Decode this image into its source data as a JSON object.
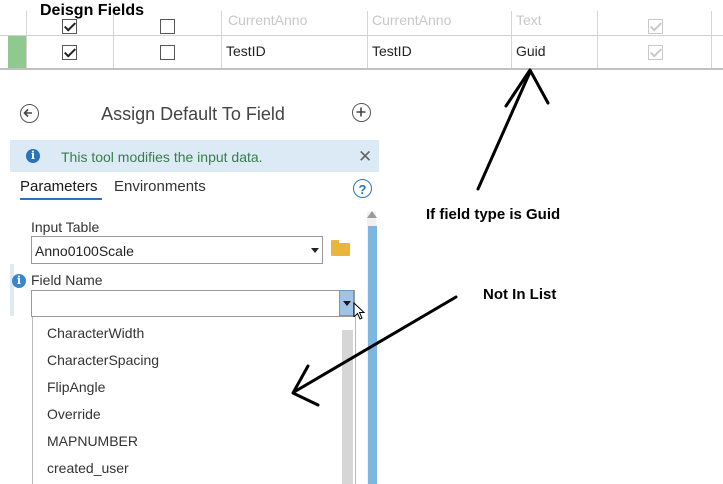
{
  "heading": "Deisgn Fields",
  "table": {
    "partial_row": {
      "col1": "CurrentAnno",
      "col2": "CurrentAnno",
      "col3": "Text"
    },
    "main_row": {
      "name": "TestID",
      "alias": "TestID",
      "type": "Guid"
    }
  },
  "pane": {
    "title": "Assign Default To Field",
    "info_message": "This tool modifies the input data.",
    "tabs": [
      {
        "label": "Parameters",
        "active": true
      },
      {
        "label": "Environments",
        "active": false
      }
    ],
    "help_glyph": "?",
    "input_table": {
      "label": "Input Table",
      "value": "Anno0100Scale"
    },
    "field_name": {
      "label": "Field Name",
      "value": ""
    },
    "dropdown_options": [
      "CharacterWidth",
      "CharacterSpacing",
      "FlipAngle",
      "Override",
      "MAPNUMBER",
      "created_user"
    ]
  },
  "annotations": {
    "guid_note": "If field type is Guid",
    "list_note": "Not In List"
  },
  "colors": {
    "accent_blue": "#2a73b8",
    "info_bar": "#dbeaf5",
    "info_text": "#3a7d4b",
    "row_marker_green": "#90c98e",
    "scroll_thumb": "#7eb6e2",
    "folder_yellow": "#e8b63a"
  },
  "icons": [
    "back-arrow-icon",
    "add-icon",
    "info-icon",
    "close-icon",
    "help-icon",
    "dropdown-arrow-icon",
    "folder-icon",
    "mouse-cursor-icon"
  ]
}
